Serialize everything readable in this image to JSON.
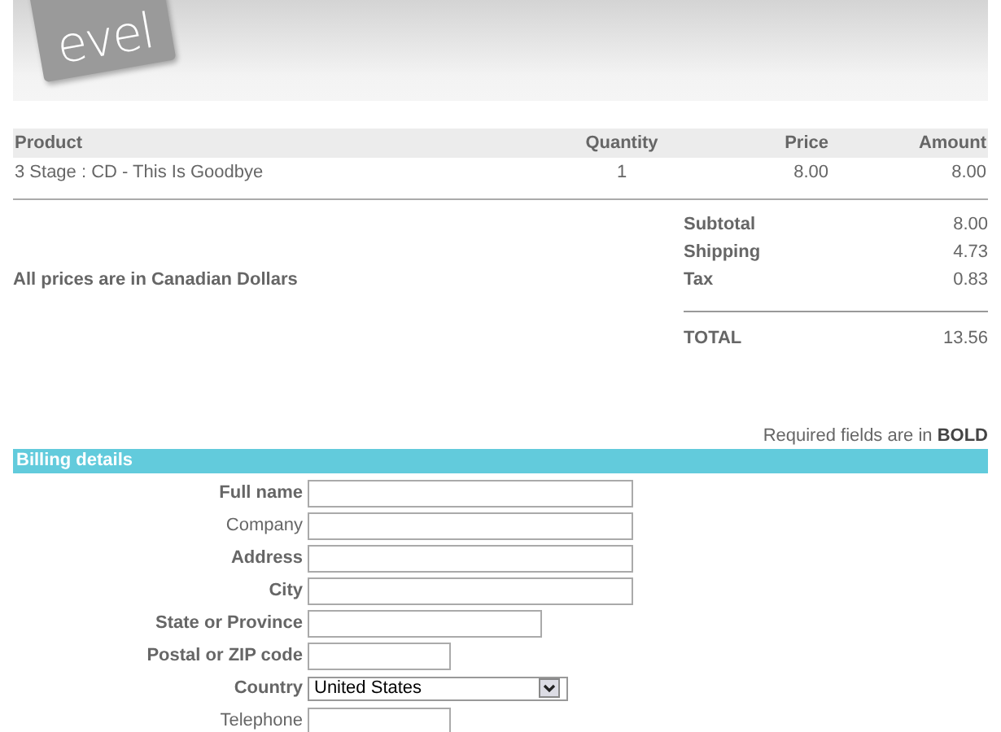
{
  "logo": {
    "text": "evel"
  },
  "table": {
    "columns": [
      "Product",
      "Quantity",
      "Price",
      "Amount"
    ],
    "rows": [
      {
        "product": "3 Stage : CD - This Is Goodbye",
        "quantity": "1",
        "price": "8.00",
        "amount": "8.00"
      }
    ]
  },
  "note": "All prices are in Canadian Dollars",
  "totals": [
    {
      "label": "Subtotal",
      "value": "8.00"
    },
    {
      "label": "Shipping",
      "value": "4.73"
    },
    {
      "label": "Tax",
      "value": "0.83"
    }
  ],
  "total": {
    "label": "TOTAL",
    "value": "13.56"
  },
  "required_note": "Required fields are in **BOLD**",
  "billing": {
    "title": "Billing details",
    "fields": [
      {
        "label": "Full name",
        "kind": "wide",
        "required": true
      },
      {
        "label": "Company",
        "kind": "wide",
        "required": false
      },
      {
        "label": "Address",
        "kind": "wide",
        "required": true
      },
      {
        "label": "City",
        "kind": "wide",
        "required": true
      },
      {
        "label": "State or Province",
        "kind": "medium",
        "required": true
      },
      {
        "label": "Postal or ZIP code",
        "kind": "narrow",
        "required": true
      },
      {
        "label": "Country",
        "kind": "select",
        "value": "United States",
        "required": true
      },
      {
        "label": "Telephone",
        "kind": "narrow",
        "required": false
      }
    ]
  }
}
